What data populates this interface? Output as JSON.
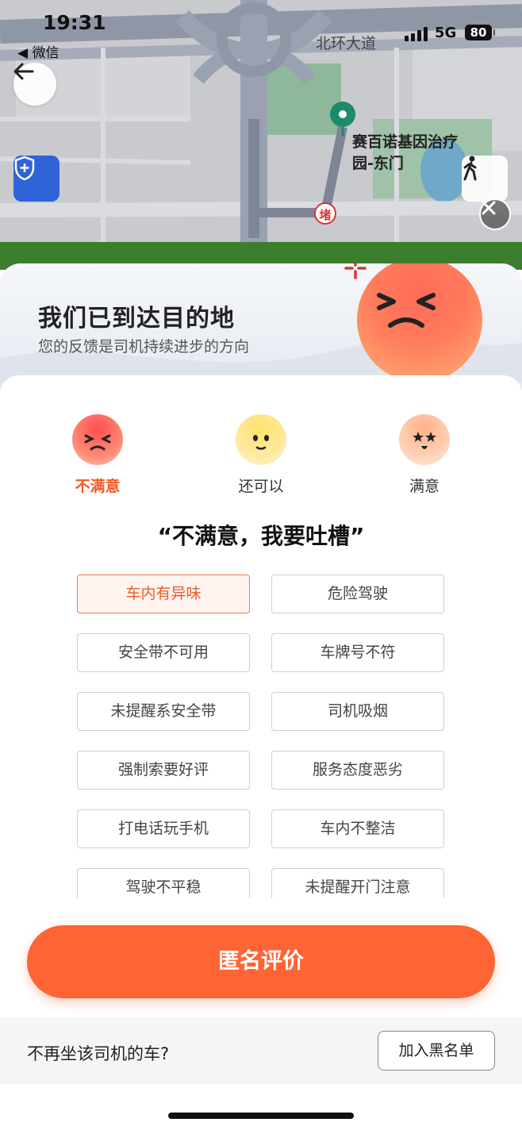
{
  "status_bar": {
    "time": "19:31",
    "back_app": "◀ 微信",
    "network": "5G",
    "battery": "80"
  },
  "map": {
    "road_label": "北环大道",
    "destination": [
      "赛百诺基因治疗",
      "园-东门"
    ],
    "toll_label": "堵"
  },
  "card": {
    "title": "我们已到达目的地",
    "subtitle": "您的反馈是司机持续进步的方向"
  },
  "moods": [
    {
      "label": "不满意",
      "active": true
    },
    {
      "label": "还可以",
      "active": false
    },
    {
      "label": "满意",
      "active": false
    }
  ],
  "prompt": "“不满意，我要吐槽”",
  "tags": [
    {
      "label": "车内有异味",
      "selected": true
    },
    {
      "label": "危险驾驶",
      "selected": false
    },
    {
      "label": "安全带不可用",
      "selected": false
    },
    {
      "label": "车牌号不符",
      "selected": false
    },
    {
      "label": "未提醒系安全带",
      "selected": false
    },
    {
      "label": "司机吸烟",
      "selected": false
    },
    {
      "label": "强制索要好评",
      "selected": false
    },
    {
      "label": "服务态度恶劣",
      "selected": false
    },
    {
      "label": "打电话玩手机",
      "selected": false
    },
    {
      "label": "车内不整洁",
      "selected": false
    },
    {
      "label": "驾驶不平稳",
      "selected": false
    },
    {
      "label": "未提醒开门注意",
      "selected": false
    }
  ],
  "submit_label": "匿名评价",
  "blacklist": {
    "question": "不再坐该司机的车?",
    "button": "加入黑名单"
  },
  "colors": {
    "accent": "#ff6434",
    "selected_text": "#ee5a26",
    "shield_button": "#2f63d8",
    "destination_pin": "#1d8a6b"
  }
}
